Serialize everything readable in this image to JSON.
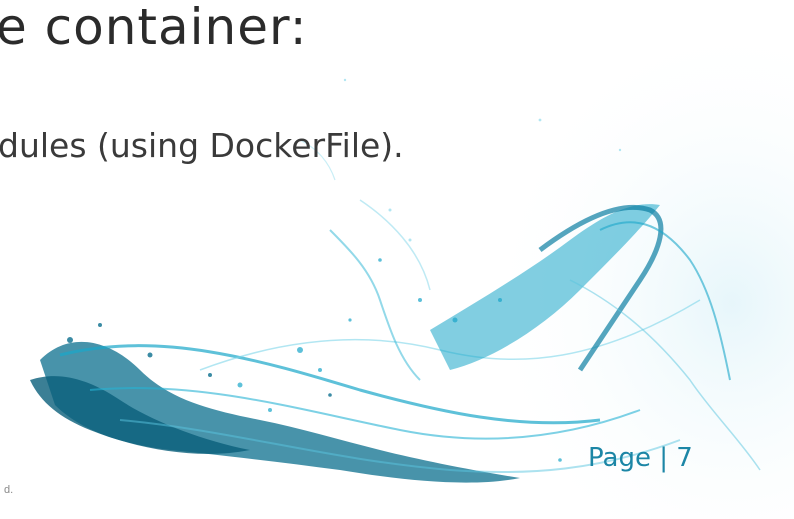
{
  "slide": {
    "heading": "e container:",
    "bullet": "dules (using DockerFile).",
    "page_number": "Page | 7",
    "footer_fragment": "d."
  },
  "decoration": {
    "image": "blue-ink-splash-in-water",
    "colors": {
      "deep": "#0b6f8e",
      "mid": "#1aa6c9",
      "light": "#7fd6ea",
      "wash": "#e4f5fa"
    }
  }
}
